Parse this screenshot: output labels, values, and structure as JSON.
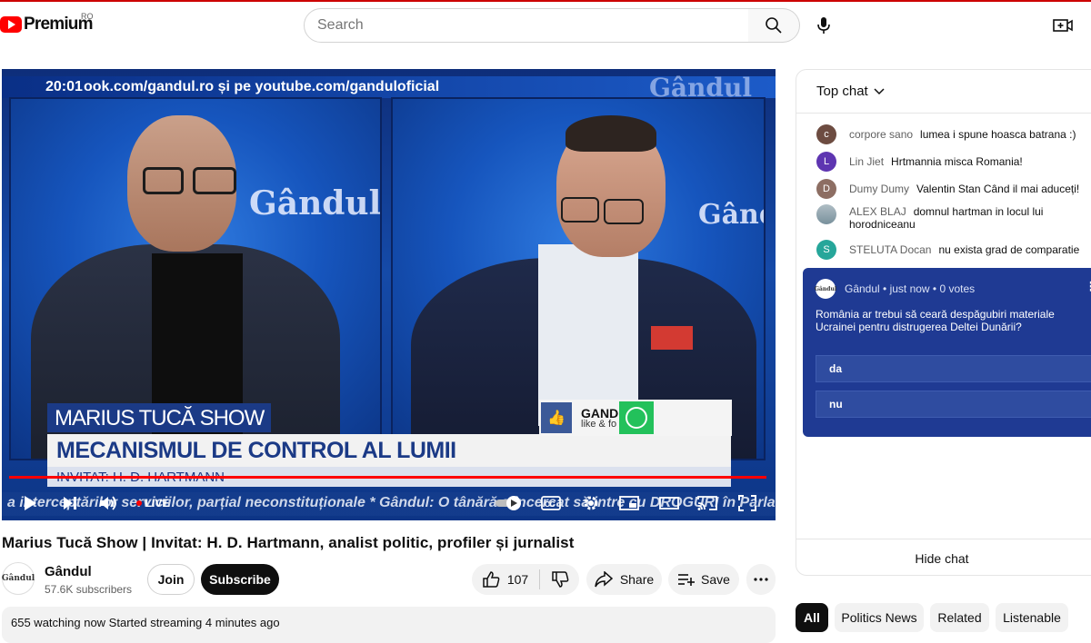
{
  "header": {
    "logo_text": "Premium",
    "country_code": "RO",
    "search_placeholder": "Search"
  },
  "player": {
    "time": "20:01",
    "top_ticker": "ook.com/gandul.ro și pe youtube.com/ganduloficial",
    "watermark": "Gândul",
    "pane_logo": "Gândul",
    "show_name": "MARIUS TUCĂ SHOW",
    "headline": "MECANISMUL DE CONTROL AL LUMII",
    "guest_line": "INVITAT: H. D. HARTMANN",
    "social_name": "GAND",
    "social_sub": "like & fo",
    "bottom_ticker": "a interceptărilor serviciilor, parțial neconstituționale * Gândul: O tânără a încercat să intre cu DROGURI în Parla",
    "live_label": "LIVE"
  },
  "video": {
    "title": "Marius Tucă Show | Invitat: H. D. Hartmann, analist politic, profiler și jurnalist",
    "channel_name": "Gândul",
    "channel_avatar_text": "Gândul",
    "subscribers": "57.6K subscribers",
    "join_label": "Join",
    "subscribe_label": "Subscribe",
    "like_count": "107",
    "share_label": "Share",
    "save_label": "Save",
    "info": "655 watching now  Started streaming 4 minutes ago"
  },
  "chat": {
    "header": "Top chat",
    "messages": [
      {
        "initial": "c",
        "color": "#6d4c41",
        "author": "corpore sano",
        "text": "lumea i spune hoasca batrana :)"
      },
      {
        "initial": "L",
        "color": "#5e35b1",
        "author": "Lin Jiet",
        "text": "Hrtmannia misca Romania!"
      },
      {
        "initial": "D",
        "color": "#8d6e63",
        "author": "Dumy Dumy",
        "text": "Valentin Stan Când il mai aduceți!"
      },
      {
        "initial": "",
        "color": "#9e9e9e",
        "author": "ALEX BLAJ",
        "text": "domnul hartman in locul lui horodniceanu"
      },
      {
        "initial": "S",
        "color": "#26a69a",
        "author": "STELUTA Docan",
        "text": "nu exista grad de comparatie"
      }
    ],
    "poll": {
      "logo_text": "Gândul",
      "meta": "Gândul • just now • 0 votes",
      "question": "România ar trebui să ceară despăgubiri materiale Ucrainei pentru distrugerea Deltei Dunării?",
      "options": [
        "da",
        "nu"
      ]
    },
    "hide_label": "Hide chat"
  },
  "chips": [
    "All",
    "Politics News",
    "Related",
    "Listenable"
  ]
}
